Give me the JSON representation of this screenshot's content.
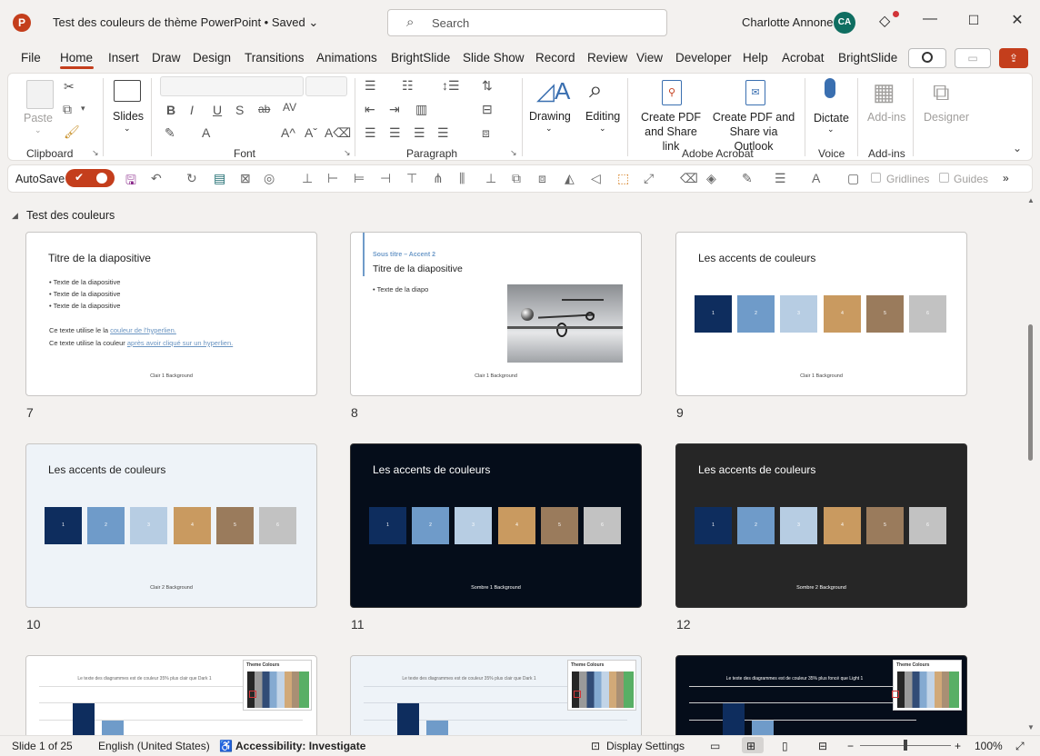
{
  "window": {
    "app_logo": "P",
    "title": "Test des couleurs de thème PowerPoint • Saved",
    "title_chevron": "⌄",
    "search_placeholder": "Search",
    "user_name": "Charlotte Annone",
    "user_initials": "CA"
  },
  "menu": {
    "tabs": [
      "File",
      "Home",
      "Insert",
      "Draw",
      "Design",
      "Transitions",
      "Animations",
      "BrightSlide",
      "Slide Show",
      "Record",
      "Review",
      "View",
      "Developer",
      "Help",
      "Acrobat",
      "BrightSlide"
    ],
    "active_tab": "Home"
  },
  "ribbon": {
    "paste": "Paste",
    "slides": "Slides",
    "drawing": "Drawing",
    "editing": "Editing",
    "create_pdf": "Create PDF and Share link",
    "create_pdf_outlook": "Create PDF and Share via Outlook",
    "dictate": "Dictate",
    "addins": "Add-ins",
    "designer": "Designer",
    "groups": {
      "clipboard": "Clipboard",
      "font": "Font",
      "paragraph": "Paragraph",
      "adobe": "Adobe Acrobat",
      "voice": "Voice",
      "addins": "Add-ins"
    }
  },
  "qat": {
    "autosave": "AutoSave",
    "gridlines": "Gridlines",
    "guides": "Guides"
  },
  "section": {
    "title": "Test des couleurs"
  },
  "slides": {
    "s7": {
      "num": "7",
      "title": "Titre de la diapositive",
      "bullets": [
        "• Texte de la diapositive",
        "• Texte de la diapositive",
        "• Texte de la diapositive"
      ],
      "line1_pre": "Ce texte utilise le la ",
      "line1_link": "couleur de l'hyperlien.",
      "line2_pre": "Ce texte utilise la couleur ",
      "line2_link": "après avoir cliqué sur un hyperlien.",
      "bg": "Clair 1 Background"
    },
    "s8": {
      "num": "8",
      "subtitle": "Sous titre – Accent 2",
      "title": "Titre de la diapositive",
      "bullet": "• Texte de la diapo",
      "bg": "Clair 1 Background"
    },
    "s9": {
      "num": "9",
      "title": "Les accents de couleurs",
      "bg": "Clair 1 Background"
    },
    "s10": {
      "num": "10",
      "title": "Les accents de couleurs",
      "bg": "Clair 2 Background"
    },
    "s11": {
      "num": "11",
      "title": "Les accents de couleurs",
      "bg": "Sombre 1 Background"
    },
    "s12": {
      "num": "12",
      "title": "Les accents de couleurs",
      "bg": "Sombre 2 Background"
    },
    "swatch_labels": [
      "1",
      "2",
      "3",
      "4",
      "5",
      "6"
    ],
    "chart_light_text": "Le texte des diagrammes est de couleur 35% plus clair que Dark 1",
    "chart_dark_text": "Le texte des diagrammes est de couleur 35% plus foncé que Light 1",
    "palette_title": "Theme Colours"
  },
  "colors": {
    "accent1": "#0e2d5e",
    "accent2": "#6f9bc9",
    "accent3": "#b7cde3",
    "accent4": "#c99a60",
    "accent5": "#9a7b5c",
    "accent6": "#c2c2c2",
    "brand": "#c43e1c",
    "dark1_bg": "#050d1a",
    "dark2_bg": "#262626",
    "light2_bg": "#eef3f8"
  },
  "status": {
    "slide_count": "Slide 1 of 25",
    "language": "English (United States)",
    "accessibility": "Accessibility: Investigate",
    "display_settings": "Display Settings",
    "zoom": "100%"
  }
}
